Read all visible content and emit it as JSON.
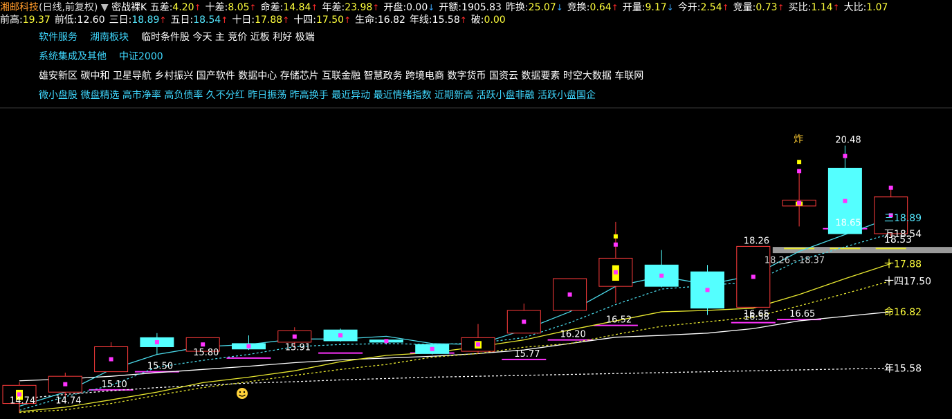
{
  "header": {
    "stock_name": "湘邮科技",
    "period": "(日线,前复权)",
    "indicator_name": "密战裸K",
    "stats_row1": [
      {
        "label": "五差:",
        "value": "4.20",
        "dir": "up",
        "color": "#ffff3c"
      },
      {
        "label": "十差:",
        "value": "8.05",
        "dir": "up",
        "color": "#ffff3c"
      },
      {
        "label": "命差:",
        "value": "14.84",
        "dir": "up",
        "color": "#ffff3c"
      },
      {
        "label": "年差:",
        "value": "23.98",
        "dir": "up",
        "color": "#ffff3c"
      },
      {
        "label": "开盘:",
        "value": "0.00",
        "dir": "down",
        "color": "#ffffff"
      },
      {
        "label": "开额:",
        "value": "1905.83",
        "dir": "",
        "color": "#ffffff"
      },
      {
        "label": "昨换:",
        "value": "25.07",
        "dir": "down",
        "color": "#ffff3c"
      },
      {
        "label": "竞换:",
        "value": "0.64",
        "dir": "up",
        "color": "#ffff3c"
      },
      {
        "label": "开量:",
        "value": "9.17",
        "dir": "down",
        "color": "#ffff3c"
      },
      {
        "label": "今开:",
        "value": "2.54",
        "dir": "up",
        "color": "#ffff3c"
      },
      {
        "label": "竞量:",
        "value": "0.73",
        "dir": "up",
        "color": "#ffff3c"
      },
      {
        "label": "买比:",
        "value": "1.14",
        "dir": "up",
        "color": "#ffff3c"
      },
      {
        "label": "大比:",
        "value": "1.07",
        "dir": "",
        "color": "#ffff3c"
      }
    ],
    "stats_row2": [
      {
        "label": "前高:",
        "value": "19.37",
        "color": "#ffff3c"
      },
      {
        "label": "前低:",
        "value": "12.60",
        "color": "#ffffff"
      },
      {
        "label": "三日:",
        "value": "18.89",
        "dir": "up",
        "color": "#54e8ff"
      },
      {
        "label": "五日:",
        "value": "18.54",
        "dir": "up",
        "color": "#54e8ff"
      },
      {
        "label": "十日:",
        "value": "17.88",
        "dir": "up",
        "color": "#ffff3c"
      },
      {
        "label": "十四:",
        "value": "17.50",
        "dir": "up",
        "color": "#ffff3c"
      },
      {
        "label": "生命:",
        "value": "16.82",
        "color": "#ffffff"
      },
      {
        "label": "年线:",
        "value": "15.58",
        "dir": "up",
        "color": "#ffffff"
      },
      {
        "label": "破:",
        "value": "0.00",
        "color": "#ffff3c"
      }
    ]
  },
  "tags": {
    "line1": [
      {
        "text": "软件服务",
        "color": "#3fd8ff"
      },
      {
        "text": "湖南板块",
        "color": "#3fd8ff"
      },
      {
        "text": "临时条件股 今天 主 竞价 近板 利好 极端",
        "color": "#ffffff"
      }
    ],
    "line2": [
      {
        "text": "系统集成及其他",
        "color": "#3fd8ff"
      },
      {
        "text": "中证2000",
        "color": "#3fd8ff"
      }
    ],
    "line3": "雄安新区 碳中和 卫星导航 乡村振兴 国产软件 数据中心 存储芯片 互联金融 智慧政务 跨境电商 数字货币 国资云 数据要素 时空大数据 车联网",
    "line4": "微小盘股 微盘精选 高市净率 高负债率 久不分红 昨日振荡 昨高换手 最近异动 最近情绪指数 近期新高 活跃小盘非融 活跃小盘国企"
  },
  "chart_data": {
    "type": "candlestick",
    "ylim": [
      14.55,
      21.25
    ],
    "colors": {
      "up": "#ff3c3c",
      "down": "#54ffff",
      "ma3": "#4ad8e8",
      "ma5": "#4ad8e8",
      "ma10": "#e8e830",
      "ma14": "#e8e830",
      "ma_life": "#ffffff",
      "ma_year": "#ffffff",
      "marker": "#ff33ff",
      "highlight": "#ffff00"
    },
    "candles": [
      {
        "o": 14.8,
        "h": 15.27,
        "l": 14.6,
        "c": 15.2,
        "hl": true
      },
      {
        "o": 15.05,
        "h": 15.48,
        "l": 14.92,
        "c": 15.4
      },
      {
        "o": 15.5,
        "h": 16.15,
        "l": 15.5,
        "c": 16.05
      },
      {
        "o": 16.25,
        "h": 16.35,
        "l": 15.88,
        "c": 16.05
      },
      {
        "o": 15.95,
        "h": 16.25,
        "l": 15.95,
        "c": 16.25
      },
      {
        "o": 16.12,
        "h": 16.3,
        "l": 15.98,
        "c": 16.0
      },
      {
        "o": 16.15,
        "h": 16.48,
        "l": 16.02,
        "c": 16.4
      },
      {
        "o": 16.42,
        "h": 16.45,
        "l": 16.16,
        "c": 16.18
      },
      {
        "o": 16.2,
        "h": 16.2,
        "l": 16.1,
        "c": 16.15
      },
      {
        "o": 16.1,
        "h": 16.13,
        "l": 15.88,
        "c": 15.9
      },
      {
        "o": 15.95,
        "h": 16.55,
        "l": 15.9,
        "c": 16.25,
        "hl": true
      },
      {
        "o": 16.35,
        "h": 17.0,
        "l": 16.35,
        "c": 16.85
      },
      {
        "o": 16.85,
        "h": 17.28,
        "l": 16.85,
        "c": 17.55
      },
      {
        "o": 17.38,
        "h": 18.8,
        "l": 17.02,
        "c": 18.0,
        "hl": true
      },
      {
        "o": 17.85,
        "h": 18.18,
        "l": 17.36,
        "c": 17.38
      },
      {
        "o": 17.7,
        "h": 17.85,
        "l": 16.75,
        "c": 16.9
      },
      {
        "o": 16.92,
        "h": 18.26,
        "l": 16.92,
        "c": 18.26
      },
      {
        "o": 19.15,
        "h": 19.95,
        "l": 18.7,
        "c": 19.28,
        "hl": true
      },
      {
        "o": 19.98,
        "h": 20.48,
        "l": 18.54,
        "c": 18.54
      },
      {
        "o": 18.54,
        "h": 19.55,
        "l": 18.48,
        "c": 19.35
      }
    ],
    "ma3": [
      14.74,
      15.05,
      15.55,
      15.88,
      16.05,
      16.1,
      16.22,
      16.22,
      16.28,
      16.12,
      16.1,
      16.42,
      16.82,
      17.38,
      17.6,
      17.42,
      17.62,
      18.15,
      18.52,
      18.89
    ],
    "ma5": [
      14.65,
      14.95,
      15.2,
      15.6,
      15.75,
      15.88,
      16.05,
      16.1,
      16.12,
      16.1,
      16.13,
      16.25,
      16.58,
      16.98,
      17.32,
      17.4,
      17.48,
      17.95,
      18.25,
      18.54
    ],
    "ma10": [
      14.62,
      14.72,
      14.88,
      15.05,
      15.26,
      15.38,
      15.52,
      15.72,
      15.86,
      15.92,
      16.05,
      16.2,
      16.42,
      16.62,
      16.82,
      16.85,
      16.9,
      17.2,
      17.55,
      17.88
    ],
    "ma14": [
      14.6,
      14.66,
      14.8,
      14.98,
      15.15,
      15.28,
      15.42,
      15.55,
      15.66,
      15.82,
      15.9,
      16.04,
      16.12,
      16.32,
      16.5,
      16.6,
      16.7,
      16.95,
      17.22,
      17.5
    ],
    "ma_life": [
      15.3,
      15.34,
      15.4,
      15.48,
      15.55,
      15.62,
      15.7,
      15.76,
      15.8,
      15.84,
      15.9,
      15.98,
      16.12,
      16.26,
      16.3,
      16.35,
      16.45,
      16.62,
      16.72,
      16.82
    ],
    "ma_year": [
      14.9,
      15.0,
      15.08,
      15.15,
      15.2,
      15.25,
      15.28,
      15.32,
      15.35,
      15.38,
      15.4,
      15.42,
      15.44,
      15.46,
      15.48,
      15.5,
      15.52,
      15.54,
      15.56,
      15.58
    ],
    "support_levels": [
      {
        "i": 2,
        "v": 15.1
      },
      {
        "i": 3,
        "v": 15.5
      },
      {
        "i": 5,
        "v": 15.8
      },
      {
        "i": 7,
        "v": 15.91
      },
      {
        "i": 9,
        "v": 15.91
      },
      {
        "i": 11,
        "v": 15.77
      },
      {
        "i": 12,
        "v": 16.2
      },
      {
        "i": 13,
        "v": 16.52
      },
      {
        "i": 16,
        "v": 16.58
      },
      {
        "i": 17,
        "v": 16.65
      },
      {
        "i": 18,
        "v": 18.65
      }
    ],
    "price_labels": [
      {
        "i": 0,
        "v": 14.74,
        "text": "14.74"
      },
      {
        "i": 1,
        "v": 14.74,
        "text": "14.74"
      },
      {
        "i": 2,
        "v": 15.1,
        "text": "15.10"
      },
      {
        "i": 3,
        "v": 15.5,
        "text": "15.50"
      },
      {
        "i": 4,
        "v": 15.8,
        "text": "15.80"
      },
      {
        "i": 6,
        "v": 15.91,
        "text": "15.91"
      },
      {
        "i": 11,
        "v": 15.77,
        "text": "15.77"
      },
      {
        "i": 12,
        "v": 16.2,
        "text": "16.20"
      },
      {
        "i": 13,
        "v": 16.52,
        "text": "16.52"
      },
      {
        "i": 16,
        "v": 16.65,
        "text": "16.65"
      },
      {
        "i": 16,
        "v": 16.58,
        "text": "16.58"
      },
      {
        "i": 17,
        "v": 16.65,
        "text": "16.65"
      },
      {
        "i": 16,
        "v": 18.26,
        "text": "18.26"
      },
      {
        "i": 18,
        "v": 18.65,
        "text": "18.65"
      },
      {
        "i": 18,
        "v": 20.48,
        "text": "20.48"
      }
    ],
    "range_label": "18.26 - 18.37",
    "range_band": [
      18.26,
      18.37
    ],
    "explode_label": "炸",
    "right_labels": [
      {
        "text": "三18.89",
        "v": 18.89,
        "color": "#54e8ff"
      },
      {
        "text": "万18.54",
        "v": 18.54,
        "color": "#ffffff"
      },
      {
        "text": "18.53",
        "v": 18.42,
        "color": "#ffffff"
      },
      {
        "text": "十17.88",
        "v": 17.88,
        "color": "#ffff3c"
      },
      {
        "text": "十四17.50",
        "v": 17.5,
        "color": "#ffffff"
      },
      {
        "text": "命16.82",
        "v": 16.82,
        "color": "#ffff3c"
      },
      {
        "text": "年15.58",
        "v": 15.58,
        "color": "#ffffff"
      }
    ]
  }
}
